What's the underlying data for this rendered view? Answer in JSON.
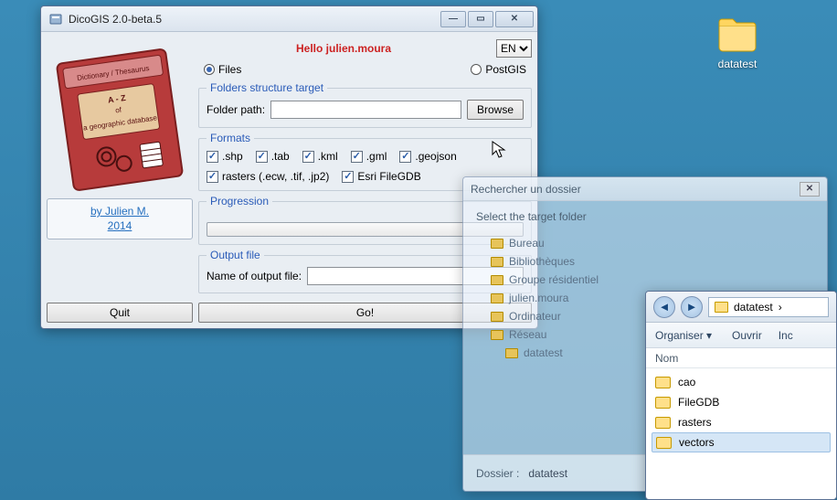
{
  "desktopIcon": {
    "label": "datatest"
  },
  "window": {
    "title": "DicoGIS 2.0-beta.5",
    "hello": "Hello julien.moura",
    "language": "EN",
    "radios": {
      "files": "Files",
      "postgis": "PostGIS"
    },
    "folderGroup": {
      "legend": "Folders structure target",
      "folderPathLabel": "Folder path:",
      "browse": "Browse"
    },
    "formatsGroup": {
      "legend": "Formats",
      "shp": ".shp",
      "tab": ".tab",
      "kml": ".kml",
      "gml": ".gml",
      "geojson": ".geojson",
      "rasters": "rasters (.ecw, .tif, .jp2)",
      "esri": "Esri FileGDB"
    },
    "progressionLegend": "Progression",
    "outputGroup": {
      "legend": "Output file",
      "label": "Name of output file:"
    },
    "book": {
      "topBanner": "Dictionary / Thesaurus",
      "line1": "A - Z",
      "line2": "of",
      "line3": "a geographic database"
    },
    "credits": {
      "author": "by Julien M.",
      "year": "2014"
    },
    "quit": "Quit",
    "go": "Go!"
  },
  "browseDialog": {
    "title": "Rechercher un dossier",
    "prompt": "Select the target folder",
    "items": [
      "Bureau",
      "Bibliothèques",
      "Groupe résidentiel",
      "julien.moura",
      "Ordinateur",
      "Réseau",
      "datatest"
    ],
    "footerLabel": "Dossier :",
    "footerValue": "datatest"
  },
  "explorer": {
    "path": "datatest",
    "organiser": "Organiser",
    "ouvrir": "Ouvrir",
    "inc": "Inc",
    "column": "Nom",
    "items": [
      "cao",
      "FileGDB",
      "rasters",
      "vectors"
    ]
  }
}
